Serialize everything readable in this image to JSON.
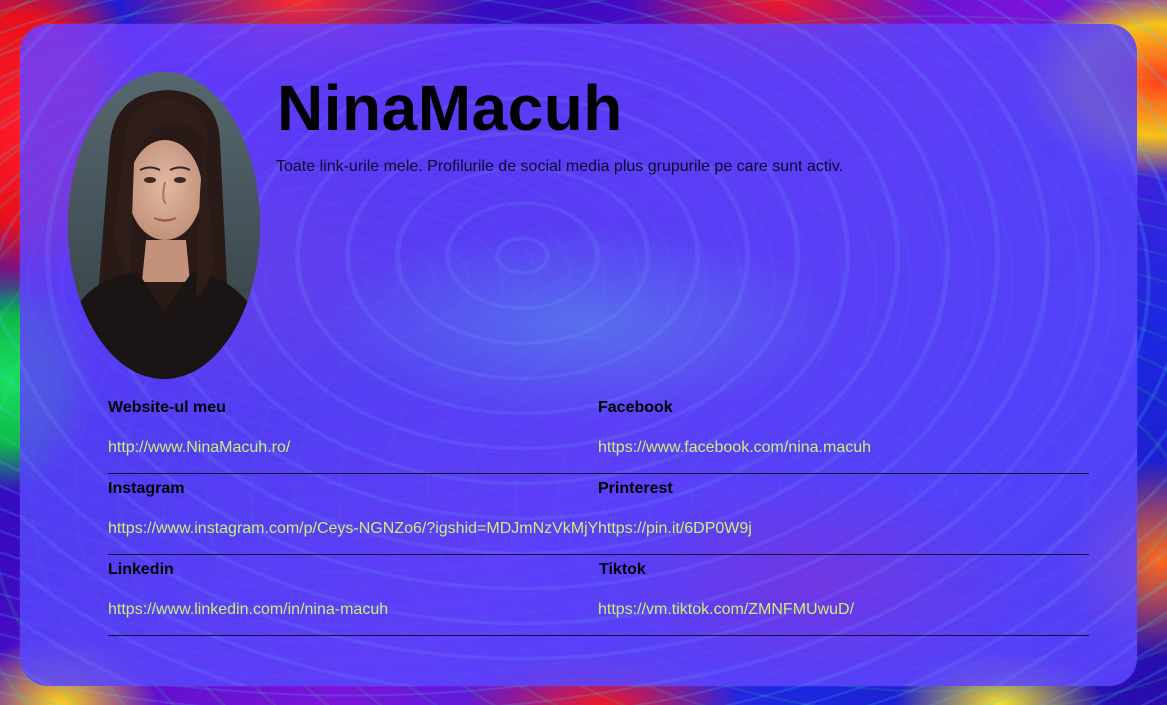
{
  "profile": {
    "name": "NinaMacuh",
    "description": "Toate link-urile mele. Profilurile de social media plus grupurile pe care sunt activ."
  },
  "links": [
    {
      "left": {
        "label": "Website-ul meu",
        "url": "http://www.NinaMacuh.ro/"
      },
      "right": {
        "label": "Facebook",
        "url": "https://www.facebook.com/nina.macuh"
      }
    },
    {
      "left": {
        "label": "Instagram",
        "url": "https://www.instagram.com/p/Ceys-NGNZo6/?igshid=MDJmNzVkMjY"
      },
      "right": {
        "label": "Printerest",
        "url": "https://pin.it/6DP0W9j"
      }
    },
    {
      "left": {
        "label": "Linkedin",
        "url": "https://www.linkedin.com/in/nina-macuh"
      },
      "right": {
        "label": "Tiktok",
        "url": "https://vm.tiktok.com/ZMNFMUwuD/"
      }
    }
  ],
  "colors": {
    "link": "#c9f07a",
    "card": "#6a46ff",
    "text": "#000000"
  }
}
